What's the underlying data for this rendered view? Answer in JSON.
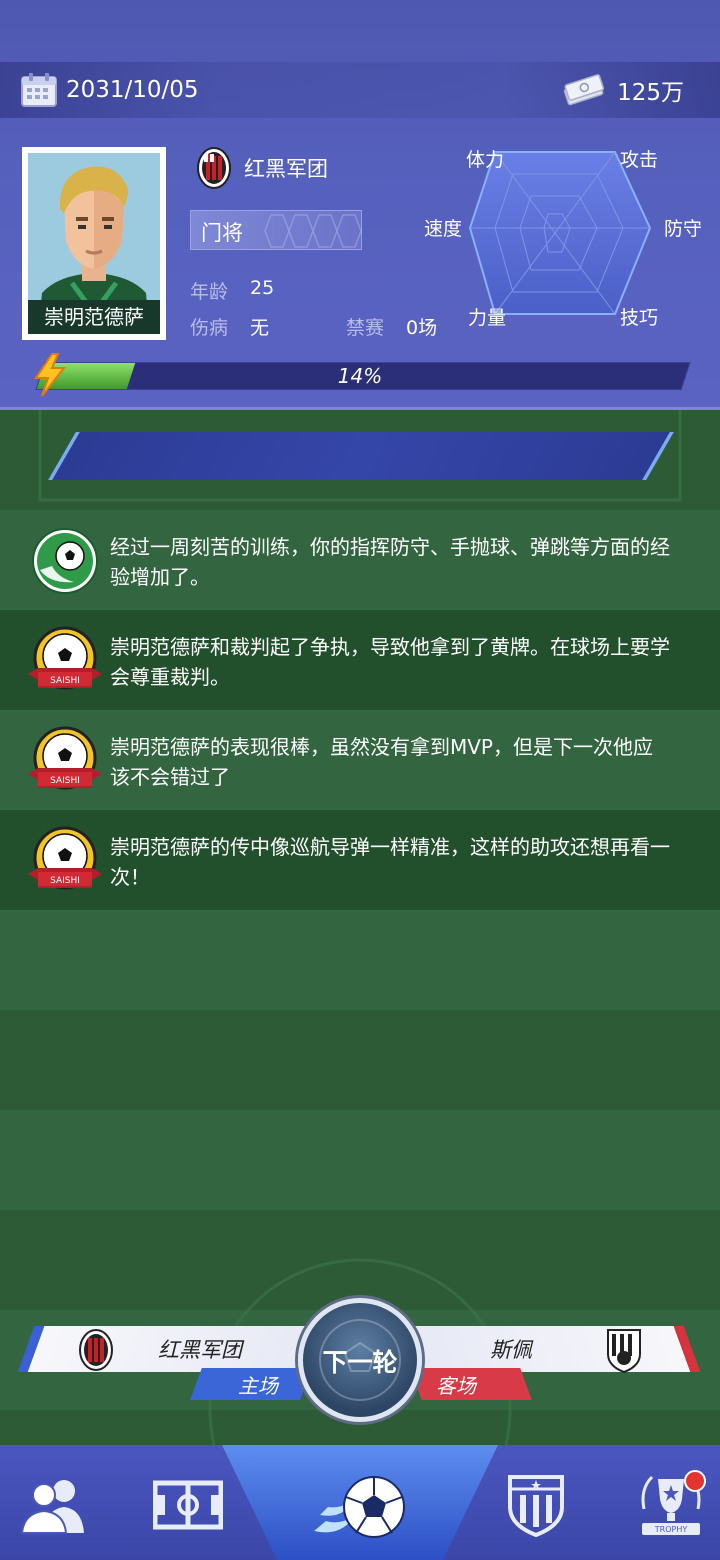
{
  "topbar": {
    "date": "2031/10/05",
    "money": "125万"
  },
  "player": {
    "name": "崇明范德萨",
    "club": "红黑军团",
    "position": "门将",
    "age_label": "年龄",
    "age": "25",
    "injury_label": "伤病",
    "injury": "无",
    "suspension_label": "禁赛",
    "suspension": "0场",
    "energy_percent": 14,
    "energy_text": "14%"
  },
  "radar": {
    "labels": {
      "stamina": "体力",
      "attack": "攻击",
      "speed": "速度",
      "defense": "防守",
      "strength": "力量",
      "skill": "技巧"
    }
  },
  "news": [
    {
      "icon": "green-ball-icon",
      "text": "经过一周刻苦的训练，你的指挥防守、手抛球、弹跳等方面的经验增加了。"
    },
    {
      "icon": "saishi-ball-icon",
      "text": "崇明范德萨和裁判起了争执，导致他拿到了黄牌。在球场上要学会尊重裁判。"
    },
    {
      "icon": "saishi-ball-icon",
      "text": "崇明范德萨的表现很棒，虽然没有拿到MVP，但是下一次他应该不会错过了"
    },
    {
      "icon": "saishi-ball-icon",
      "text": "崇明范德萨的传中像巡航导弹一样精准，这样的助攻还想再看一次！"
    }
  ],
  "badge_text": "SAISHI",
  "match": {
    "home_team": "红黑军团",
    "home_label": "主场",
    "away_team": "斯佩",
    "away_label": "客场",
    "next_round": "下一轮"
  },
  "nav": {
    "items": [
      "team-icon",
      "formation-icon",
      "match-icon",
      "club-icon",
      "trophy-icon"
    ],
    "trophy_caption": "TROPHY"
  },
  "colors": {
    "header": "#5560bd",
    "field_dark": "#2c5b35",
    "field_light": "#336640",
    "home": "#3b66d8",
    "away": "#d83b47",
    "notification": "#e3342f"
  }
}
